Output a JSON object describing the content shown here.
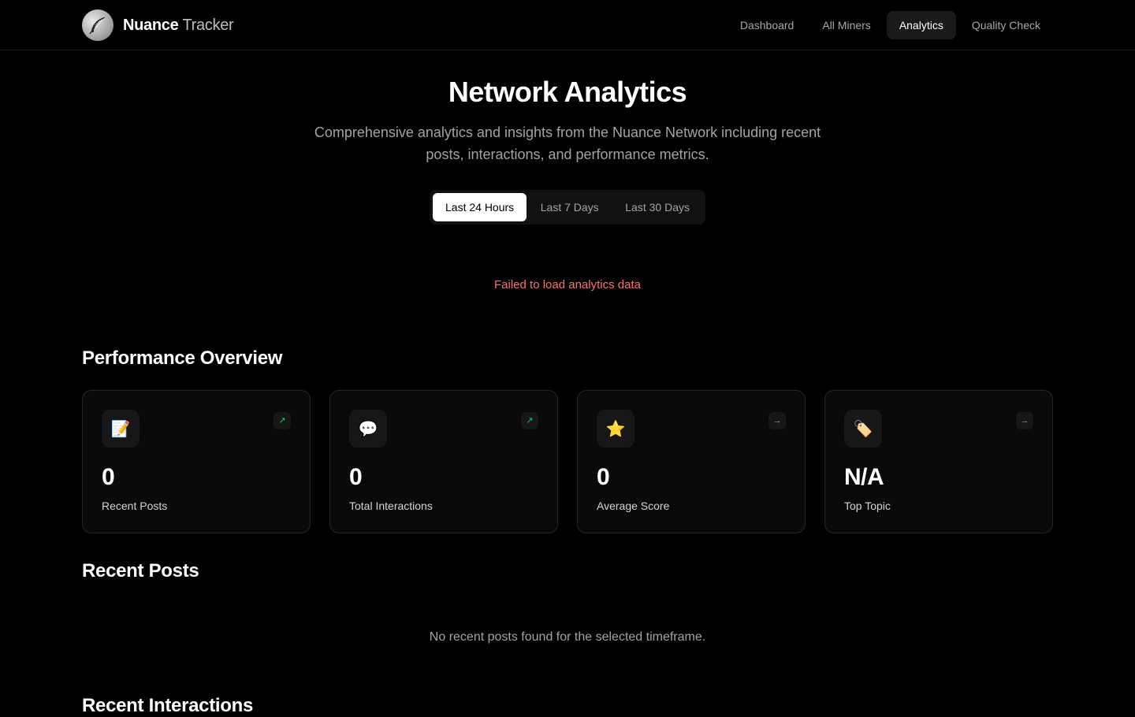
{
  "header": {
    "brand_bold": "Nuance",
    "brand_light": "Tracker",
    "nav": [
      {
        "label": "Dashboard"
      },
      {
        "label": "All Miners"
      },
      {
        "label": "Analytics"
      },
      {
        "label": "Quality Check"
      }
    ],
    "active_nav": "Analytics"
  },
  "hero": {
    "title": "Network Analytics",
    "subtitle": "Comprehensive analytics and insights from the Nuance Network including recent posts, interactions, and performance metrics.",
    "timeframes": [
      {
        "label": "Last 24 Hours"
      },
      {
        "label": "Last 7 Days"
      },
      {
        "label": "Last 30 Days"
      }
    ],
    "selected_timeframe": "Last 24 Hours",
    "error": "Failed to load analytics data"
  },
  "performance": {
    "title": "Performance Overview",
    "cards": [
      {
        "icon": "memo-icon",
        "glyph": "📝",
        "trend": "up",
        "trend_glyph": "↗",
        "value": "0",
        "label": "Recent Posts"
      },
      {
        "icon": "speech-bubble-icon",
        "glyph": "💬",
        "trend": "up",
        "trend_glyph": "↗",
        "value": "0",
        "label": "Total Interactions"
      },
      {
        "icon": "star-icon",
        "glyph": "⭐",
        "trend": "flat",
        "trend_glyph": "→",
        "value": "0",
        "label": "Average Score"
      },
      {
        "icon": "tag-icon",
        "glyph": "🏷️",
        "trend": "flat",
        "trend_glyph": "→",
        "value": "N/A",
        "label": "Top Topic"
      }
    ]
  },
  "recent_posts": {
    "title": "Recent Posts",
    "empty": "No recent posts found for the selected timeframe."
  },
  "recent_interactions": {
    "title": "Recent Interactions"
  },
  "colors": {
    "background": "#000000",
    "card_bg": "#0a0a0a",
    "error": "#f87171",
    "trend_up": "#22c55e"
  }
}
